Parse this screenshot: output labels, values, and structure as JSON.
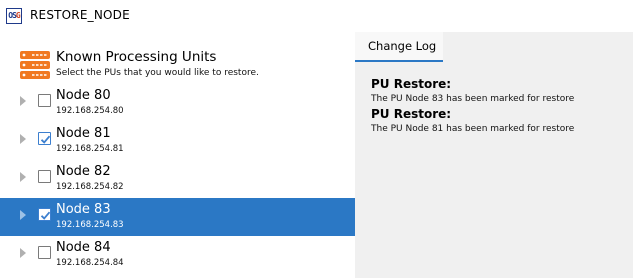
{
  "window": {
    "title": "RESTORE_NODE",
    "app_icon_letters": [
      "O",
      "S",
      "G"
    ]
  },
  "header": {
    "title": "Known Processing Units",
    "subtitle": "Select the PUs that you would like to restore.",
    "icon": "server-icon",
    "icon_color": "#f07820"
  },
  "nodes": [
    {
      "name": "Node 80",
      "ip": "192.168.254.80",
      "checked": false,
      "selected": false
    },
    {
      "name": "Node 81",
      "ip": "192.168.254.81",
      "checked": true,
      "selected": false
    },
    {
      "name": "Node 82",
      "ip": "192.168.254.82",
      "checked": false,
      "selected": false
    },
    {
      "name": "Node 83",
      "ip": "192.168.254.83",
      "checked": true,
      "selected": true
    },
    {
      "name": "Node 84",
      "ip": "192.168.254.84",
      "checked": false,
      "selected": false
    }
  ],
  "tabs": [
    {
      "label": "Change Log",
      "active": true
    }
  ],
  "log": [
    {
      "heading": "PU Restore:",
      "message": "The PU Node 83 has been marked for restore"
    },
    {
      "heading": "PU Restore:",
      "message": "The PU Node 81 has been marked for restore"
    }
  ],
  "colors": {
    "selection": "#2b78c5",
    "check": "#3c7fcf",
    "panel_bg": "#f0f0f0"
  }
}
